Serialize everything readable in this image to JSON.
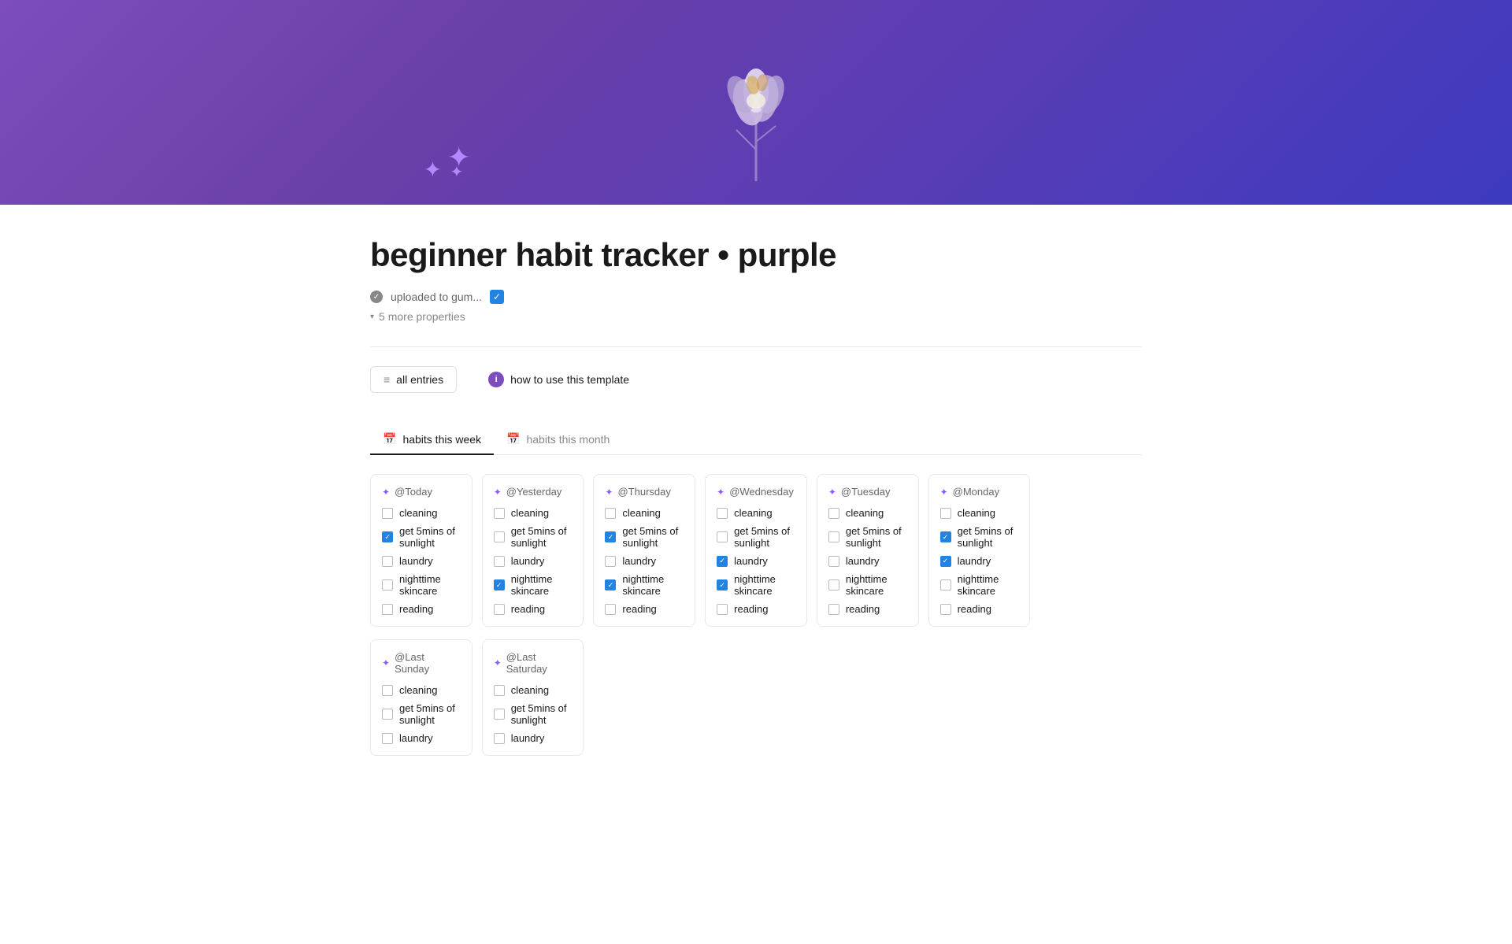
{
  "hero": {
    "alt": "purple flower bouquet illustration"
  },
  "page": {
    "title": "beginner habit tracker • purple",
    "property_label": "uploaded to gum...",
    "more_properties": "5 more properties",
    "all_entries_label": "all entries",
    "how_to_use_label": "how to use this template"
  },
  "tabs": [
    {
      "id": "week",
      "label": "habits this week",
      "icon": "📅",
      "active": true
    },
    {
      "id": "month",
      "label": "habits this month",
      "icon": "📅",
      "active": false
    }
  ],
  "days_row1": [
    {
      "title": "@Today",
      "habits": [
        {
          "label": "cleaning",
          "checked": false
        },
        {
          "label": "get 5mins of sunlight",
          "checked": true
        },
        {
          "label": "laundry",
          "checked": false
        },
        {
          "label": "nighttime skincare",
          "checked": false
        },
        {
          "label": "reading",
          "checked": false
        }
      ]
    },
    {
      "title": "@Yesterday",
      "habits": [
        {
          "label": "cleaning",
          "checked": false
        },
        {
          "label": "get 5mins of sunlight",
          "checked": false
        },
        {
          "label": "laundry",
          "checked": false
        },
        {
          "label": "nighttime skincare",
          "checked": true
        },
        {
          "label": "reading",
          "checked": false
        }
      ]
    },
    {
      "title": "@Thursday",
      "habits": [
        {
          "label": "cleaning",
          "checked": false
        },
        {
          "label": "get 5mins of sunlight",
          "checked": true
        },
        {
          "label": "laundry",
          "checked": false
        },
        {
          "label": "nighttime skincare",
          "checked": true
        },
        {
          "label": "reading",
          "checked": false
        }
      ]
    },
    {
      "title": "@Wednesday",
      "habits": [
        {
          "label": "cleaning",
          "checked": false
        },
        {
          "label": "get 5mins of sunlight",
          "checked": false
        },
        {
          "label": "laundry",
          "checked": true
        },
        {
          "label": "nighttime skincare",
          "checked": true
        },
        {
          "label": "reading",
          "checked": false
        }
      ]
    },
    {
      "title": "@Tuesday",
      "habits": [
        {
          "label": "cleaning",
          "checked": false
        },
        {
          "label": "get 5mins of sunlight",
          "checked": false
        },
        {
          "label": "laundry",
          "checked": false
        },
        {
          "label": "nighttime skincare",
          "checked": false
        },
        {
          "label": "reading",
          "checked": false
        }
      ]
    },
    {
      "title": "@Monday",
      "habits": [
        {
          "label": "cleaning",
          "checked": false
        },
        {
          "label": "get 5mins of sunlight",
          "checked": true
        },
        {
          "label": "laundry",
          "checked": true
        },
        {
          "label": "nighttime skincare",
          "checked": false
        },
        {
          "label": "reading",
          "checked": false
        }
      ]
    }
  ],
  "days_row2": [
    {
      "title": "@Last Sunday",
      "habits": [
        {
          "label": "cleaning",
          "checked": false
        },
        {
          "label": "get 5mins of sunlight",
          "checked": false
        },
        {
          "label": "laundry",
          "checked": false
        }
      ]
    },
    {
      "title": "@Last Saturday",
      "habits": [
        {
          "label": "cleaning",
          "checked": false
        },
        {
          "label": "get 5mins of sunlight",
          "checked": false
        },
        {
          "label": "laundry",
          "checked": false
        }
      ]
    }
  ]
}
